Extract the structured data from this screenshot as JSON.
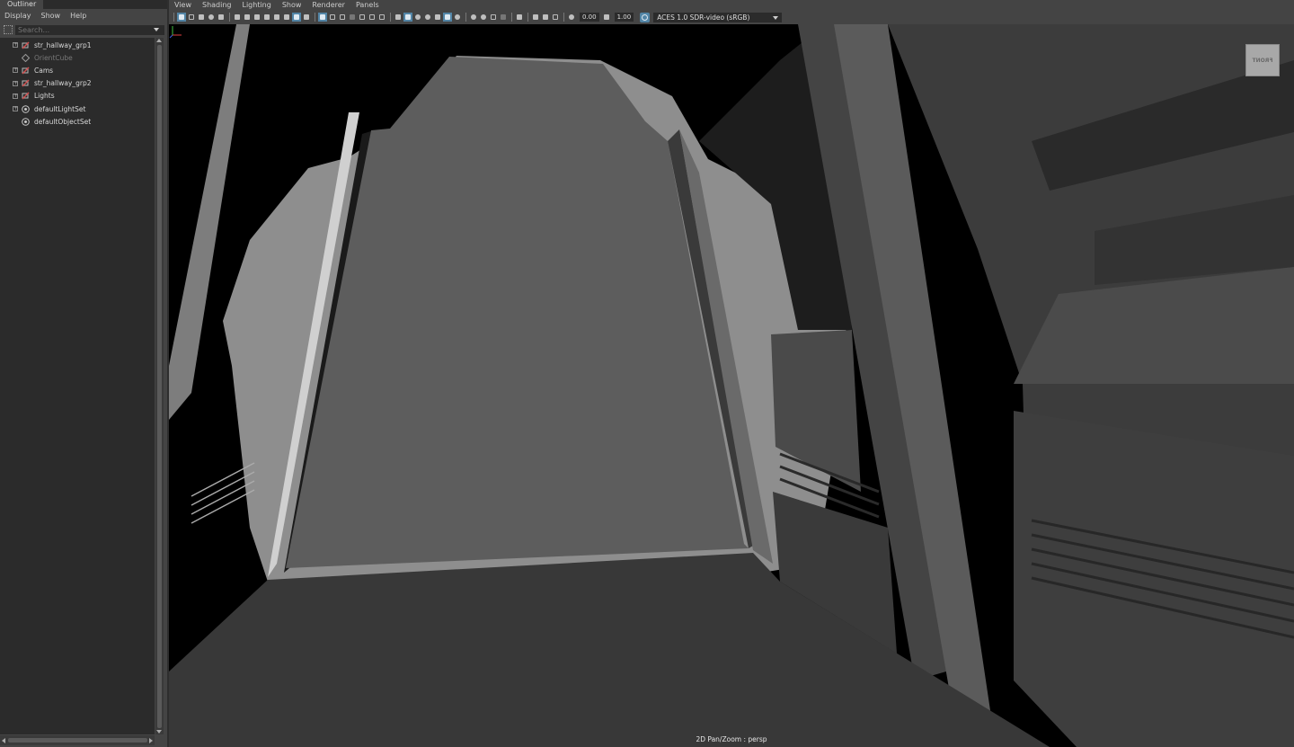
{
  "outliner": {
    "tab_label": "Outliner",
    "menu": [
      "Display",
      "Show",
      "Help"
    ],
    "search_placeholder": "Search...",
    "items": [
      {
        "label": "str_hallway_grp1",
        "icon": "group-icon",
        "expandable": true,
        "dim": false
      },
      {
        "label": "OrientCube",
        "icon": "transform-icon",
        "expandable": false,
        "dim": true
      },
      {
        "label": "Cams",
        "icon": "group-icon",
        "expandable": true,
        "dim": false
      },
      {
        "label": "str_hallway_grp2",
        "icon": "group-icon",
        "expandable": true,
        "dim": false
      },
      {
        "label": "Lights",
        "icon": "group-icon",
        "expandable": true,
        "dim": false
      },
      {
        "label": "defaultLightSet",
        "icon": "set-icon",
        "expandable": true,
        "dim": false
      },
      {
        "label": "defaultObjectSet",
        "icon": "set-icon",
        "expandable": false,
        "dim": false
      }
    ]
  },
  "viewport": {
    "menu": [
      "View",
      "Shading",
      "Lighting",
      "Show",
      "Renderer",
      "Panels"
    ],
    "exposure_value": "0.00",
    "gamma_value": "1.00",
    "color_management": "ACES 1.0 SDR-video (sRGB)",
    "camera_label": "2D Pan/Zoom : persp",
    "viewcube_label": "FRONT"
  },
  "colors": {
    "panel_bg": "#444444",
    "field_bg": "#2b2b2b",
    "accent_active": "#5285a6",
    "viewport_bg": "#000000"
  }
}
